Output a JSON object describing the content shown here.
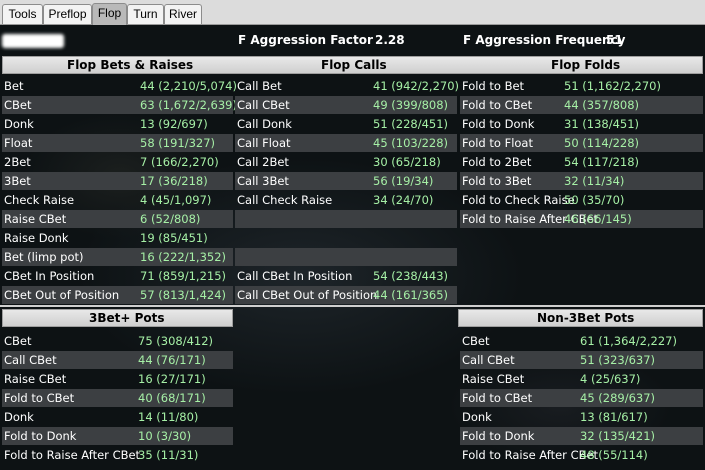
{
  "tabs": [
    {
      "label": "Tools",
      "active": false
    },
    {
      "label": "Preflop",
      "active": false
    },
    {
      "label": "Flop",
      "active": true
    },
    {
      "label": "Turn",
      "active": false
    },
    {
      "label": "River",
      "active": false
    }
  ],
  "header": {
    "aggression_factor_label": "F Aggression Factor",
    "aggression_factor_value": "2.28",
    "aggression_frequency_label": "F Aggression Frequency",
    "aggression_frequency_value": "51"
  },
  "flop_bets_raises": {
    "title": "Flop Bets & Raises",
    "rows": [
      {
        "label": "Bet",
        "value": "44 (2,210/5,074)"
      },
      {
        "label": "CBet",
        "value": "63 (1,672/2,639)"
      },
      {
        "label": "Donk",
        "value": "13 (92/697)"
      },
      {
        "label": "Float",
        "value": "58 (191/327)"
      },
      {
        "label": "2Bet",
        "value": "7 (166/2,270)"
      },
      {
        "label": "3Bet",
        "value": "17 (36/218)"
      },
      {
        "label": "Check Raise",
        "value": "4 (45/1,097)"
      },
      {
        "label": "Raise CBet",
        "value": "6 (52/808)"
      },
      {
        "label": "Raise Donk",
        "value": "19 (85/451)"
      },
      {
        "label": "Bet (limp pot)",
        "value": "16 (222/1,352)"
      },
      {
        "label": "CBet In Position",
        "value": "71 (859/1,215)"
      },
      {
        "label": "CBet Out of Position",
        "value": "57 (813/1,424)"
      }
    ]
  },
  "flop_calls": {
    "title": "Flop Calls",
    "rows": [
      {
        "label": "Call Bet",
        "value": "41 (942/2,270)"
      },
      {
        "label": "Call CBet",
        "value": "49 (399/808)"
      },
      {
        "label": "Call Donk",
        "value": "51 (228/451)"
      },
      {
        "label": "Call Float",
        "value": "45 (103/228)"
      },
      {
        "label": "Call 2Bet",
        "value": "30 (65/218)"
      },
      {
        "label": "Call 3Bet",
        "value": "56 (19/34)"
      },
      {
        "label": "Call Check Raise",
        "value": "34 (24/70)"
      },
      {
        "label": "",
        "value": ""
      },
      {
        "label": "",
        "value": ""
      },
      {
        "label": "",
        "value": ""
      },
      {
        "label": "Call CBet In Position",
        "value": "54 (238/443)"
      },
      {
        "label": "Call CBet Out of Position",
        "value": "44 (161/365)"
      }
    ]
  },
  "flop_folds": {
    "title": "Flop Folds",
    "rows": [
      {
        "label": "Fold to Bet",
        "value": "51 (1,162/2,270)"
      },
      {
        "label": "Fold to CBet",
        "value": "44 (357/808)"
      },
      {
        "label": "Fold to Donk",
        "value": "31 (138/451)"
      },
      {
        "label": "Fold to Float",
        "value": "50 (114/228)"
      },
      {
        "label": "Fold to 2Bet",
        "value": "54 (117/218)"
      },
      {
        "label": "Fold to 3Bet",
        "value": "32 (11/34)"
      },
      {
        "label": "Fold to Check Raise",
        "value": "50 (35/70)"
      },
      {
        "label": "Fold to Raise After CBet",
        "value": "46 (66/145)"
      }
    ]
  },
  "three_bet_pots": {
    "title": "3Bet+ Pots",
    "rows": [
      {
        "label": "CBet",
        "value": "75 (308/412)"
      },
      {
        "label": "Call CBet",
        "value": "44 (76/171)"
      },
      {
        "label": "Raise CBet",
        "value": "16 (27/171)"
      },
      {
        "label": "Fold to CBet",
        "value": "40 (68/171)"
      },
      {
        "label": "Donk",
        "value": "14 (11/80)"
      },
      {
        "label": "Fold to Donk",
        "value": "10 (3/30)"
      },
      {
        "label": "Fold to Raise After CBet",
        "value": "35 (11/31)"
      }
    ]
  },
  "non_three_bet_pots": {
    "title": "Non-3Bet Pots",
    "rows": [
      {
        "label": "CBet",
        "value": "61 (1,364/2,227)"
      },
      {
        "label": "Call CBet",
        "value": "51 (323/637)"
      },
      {
        "label": "Raise CBet",
        "value": "4 (25/637)"
      },
      {
        "label": "Fold to CBet",
        "value": "45 (289/637)"
      },
      {
        "label": "Donk",
        "value": "13 (81/617)"
      },
      {
        "label": "Fold to Donk",
        "value": "32 (135/421)"
      },
      {
        "label": "Fold to Raise After CBet",
        "value": "48 (55/114)"
      }
    ]
  },
  "colors": {
    "value_text": "#a6f0a6",
    "label_text": "#ffffff",
    "row_shade": "#3c3f42",
    "background": "#0d1214"
  }
}
